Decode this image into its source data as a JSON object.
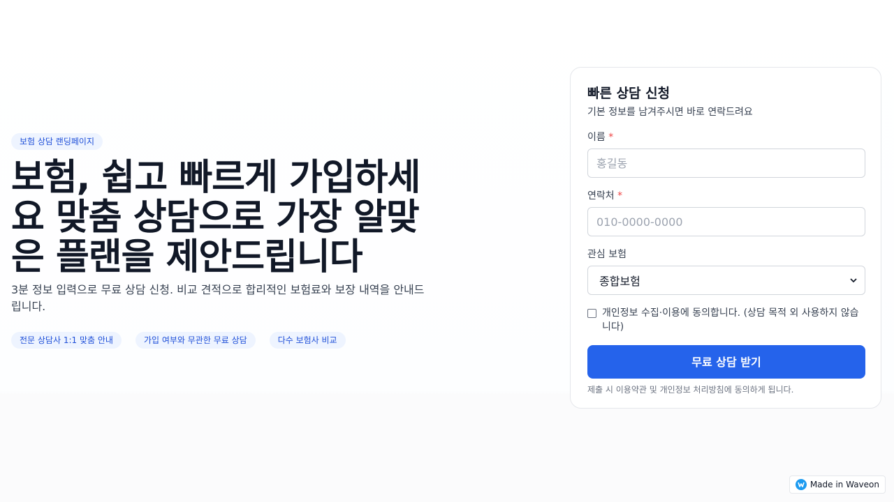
{
  "hero": {
    "pill": "보험 상담 랜딩페이지",
    "title": "보험, 쉽고 빠르게 가입하세요 맞춤 상담으로 가장 알맞은 플랜을 제안드립니다",
    "subtitle": "3분 정보 입력으로 무료 상담 신청. 비교 견적으로 합리적인 보험료와 보장 내역을 안내드립니다.",
    "tags": [
      "전문 상담사 1:1 맞춤 안내",
      "가입 여부와 무관한 무료 상담",
      "다수 보험사 비교"
    ]
  },
  "form": {
    "title": "빠른 상담 신청",
    "subtitle": "기본 정보를 남겨주시면 바로 연락드려요",
    "name": {
      "label": "이름",
      "required_mark": "*",
      "placeholder": "홍길동",
      "value": ""
    },
    "phone": {
      "label": "연락처",
      "required_mark": "*",
      "placeholder": "010-0000-0000",
      "value": ""
    },
    "interest": {
      "label": "관심 보험",
      "selected": "종합보험"
    },
    "consent": {
      "label": "개인정보 수집·이용에 동의합니다. (상담 목적 외 사용하지 않습니다)",
      "checked": false
    },
    "submit_label": "무료 상담 받기",
    "note": "제출 시 이용약관 및 개인정보 처리방침에 동의하게 됩니다."
  },
  "badge": {
    "label": "Made in Waveon",
    "logo_icon": "waveon-logo-icon",
    "accent": "#1d9bf0"
  },
  "colors": {
    "primary": "#2563eb",
    "pill_bg": "#eef4ff",
    "pill_text": "#1d4ed8",
    "required": "#ef4444"
  }
}
